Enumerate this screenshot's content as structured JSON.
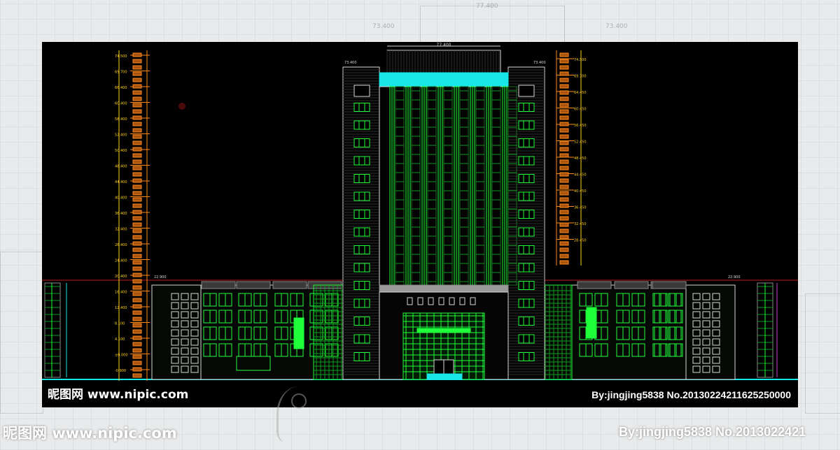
{
  "watermark": {
    "site_cn": "昵图网",
    "site_url": "www.nipic.com",
    "author": "By:jingjing5838",
    "number": "No.20130224211625250000",
    "number_truncated": "No.2013022421"
  },
  "drawing": {
    "top_dim": "77.400",
    "left_dim": "73.400",
    "right_dim": "73.400",
    "podium_left_dim": "22.900",
    "podium_right_dim": "22.900",
    "left_levels": [
      "74.500",
      "69.700",
      "66.400",
      "60.400",
      "58.400",
      "52.400",
      "50.400",
      "48.400",
      "44.400",
      "40.400",
      "36.400",
      "32.400",
      "28.400",
      "24.400",
      "20.400",
      "16.400",
      "12.400",
      "8.100",
      "4.100",
      "±0.000",
      "-0.900"
    ],
    "right_levels": [
      "74.500",
      "69.700",
      "64.450",
      "60.450",
      "56.450",
      "52.450",
      "48.450",
      "44.450",
      "40.450",
      "36.450",
      "32.450",
      "28.450"
    ]
  },
  "colors": {
    "green": "#1fff3a",
    "green_dim": "#0e9a1e",
    "cyan": "#19e6e6",
    "white_line": "#d8d8d8",
    "yellow": "#ffd21a",
    "orange": "#ff8a1a",
    "red_line": "#c0202a",
    "gray": "#8a8a8a"
  }
}
